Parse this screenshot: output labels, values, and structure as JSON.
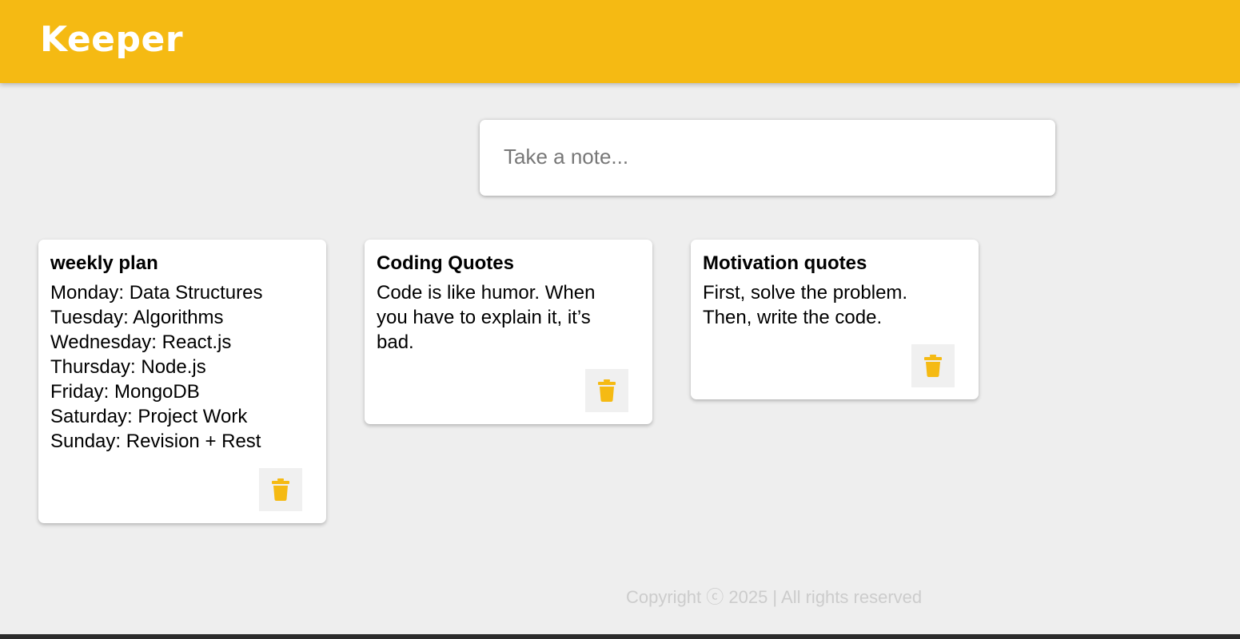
{
  "header": {
    "title": "Keeper"
  },
  "create_note": {
    "placeholder": "Take a note..."
  },
  "notes": [
    {
      "title": "weekly plan",
      "content": "Monday: Data Structures\nTuesday: Algorithms\nWednesday: React.js\nThursday: Node.js\n Friday: MongoDB\nSaturday: Project Work\nSunday: Revision + Rest"
    },
    {
      "title": "Coding Quotes",
      "content": "Code is like humor. When you have to explain it, it’s bad."
    },
    {
      "title": "Motivation quotes",
      "content": "First, solve the problem. Then, write the code."
    }
  ],
  "footer": {
    "text": "Copyright ⓒ 2025 | All rights reserved"
  },
  "icons": {
    "delete": "trash-icon"
  },
  "colors": {
    "accent": "#f5ba13",
    "background": "#eeeeee",
    "footer_text": "#cccccc"
  }
}
